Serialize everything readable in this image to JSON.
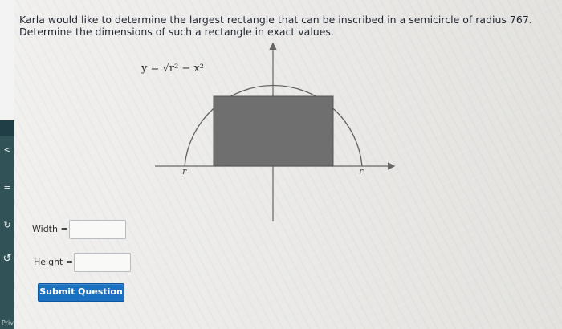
{
  "question": {
    "line1": "Karla would like to determine the largest rectangle that can be inscribed in a semicircle of radius 767.",
    "line2": "Determine the dimensions of such a rectangle in exact values."
  },
  "graph": {
    "formula": "y = √r² − x²",
    "left_label": "r",
    "right_label": "r"
  },
  "fields": {
    "width_label": "Width =",
    "width_value": "",
    "height_label": "Height =",
    "height_value": ""
  },
  "submit": {
    "label": "Submit Question"
  },
  "sidebar": {
    "footer": "Priv",
    "icon1": "<",
    "icon2": "≡",
    "icon3": "↻",
    "icon4": "↺"
  },
  "colors": {
    "accent": "#1a71c2",
    "rectangle": "#6f6f6f",
    "axis": "#666666"
  }
}
